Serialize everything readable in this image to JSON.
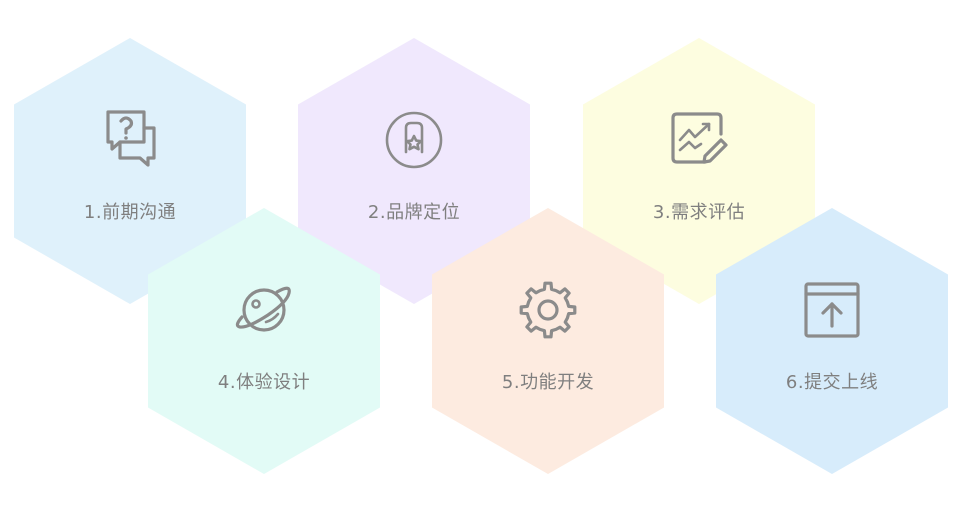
{
  "steps": [
    {
      "label": "1.前期沟通",
      "icon": "chat-question-icon",
      "color": "#dff1fb"
    },
    {
      "label": "2.品牌定位",
      "icon": "badge-star-icon",
      "color": "#f0e8fd"
    },
    {
      "label": "3.需求评估",
      "icon": "chart-edit-icon",
      "color": "#fdfde0"
    },
    {
      "label": "4.体验设计",
      "icon": "planet-icon",
      "color": "#e2fbf6"
    },
    {
      "label": "5.功能开发",
      "icon": "gear-icon",
      "color": "#fdebe0"
    },
    {
      "label": "6.提交上线",
      "icon": "upload-box-icon",
      "color": "#d7ecfb"
    }
  ],
  "colors": {
    "icon_stroke": "#8b8b8b",
    "label_text": "#7f7f7f"
  }
}
